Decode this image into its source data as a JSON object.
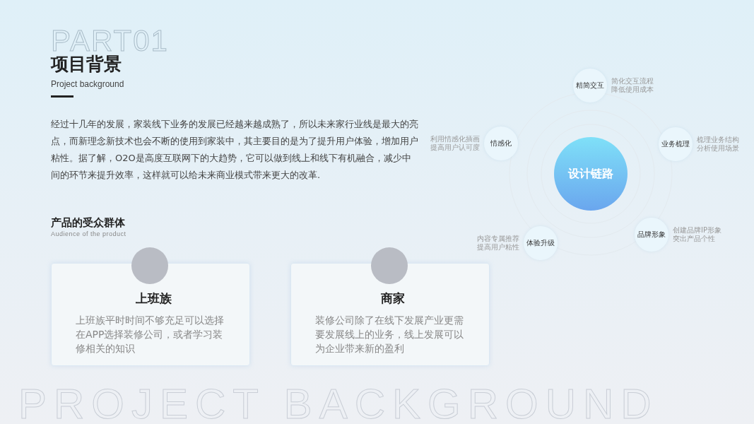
{
  "header": {
    "watermark": "PART01",
    "title": "项目背景",
    "subtitle": "Project background"
  },
  "intro": "经过十几年的发展，家装线下业务的发展已经越来越成熟了，所以未来家行业线是最大的亮点，而新理念新技术也会不断的使用到家装中，其主要目的是为了提升用户体验，增加用户粘性。据了解，O2O是高度互联网下的大趋势，它可以做到线上和线下有机融合，减少中间的环节来提升效率，这样就可以给未来商业模式带来更大的改革.",
  "audience": {
    "title": "产品的受众群体",
    "subtitle": "Audience of the product",
    "cards": [
      {
        "name": "上班族",
        "description": "上班族平时时间不够充足可以选择在APP选择装修公司，或者学习装修相关的知识"
      },
      {
        "name": "商家",
        "description": "装修公司除了在线下发展产业更需要发展线上的业务，线上发展可以为企业带来新的盈利"
      }
    ]
  },
  "diagram": {
    "center": "设计链路",
    "nodes": [
      {
        "label": "精简交互",
        "note": [
          "简化交互流程",
          "降低使用成本"
        ]
      },
      {
        "label": "业务梳理",
        "note": [
          "梳理业务结构",
          "分析使用场景"
        ]
      },
      {
        "label": "品牌形象",
        "note": [
          "创建品牌IP形象",
          "突出产品个性"
        ]
      },
      {
        "label": "体验升级",
        "note": [
          "内容专属推荐",
          "提高用户粘性"
        ]
      },
      {
        "label": "情感化",
        "note": [
          "利用情感化插画",
          "提高用户认可度"
        ]
      }
    ]
  },
  "footer_watermark": "PROJECT BACKGROUND"
}
